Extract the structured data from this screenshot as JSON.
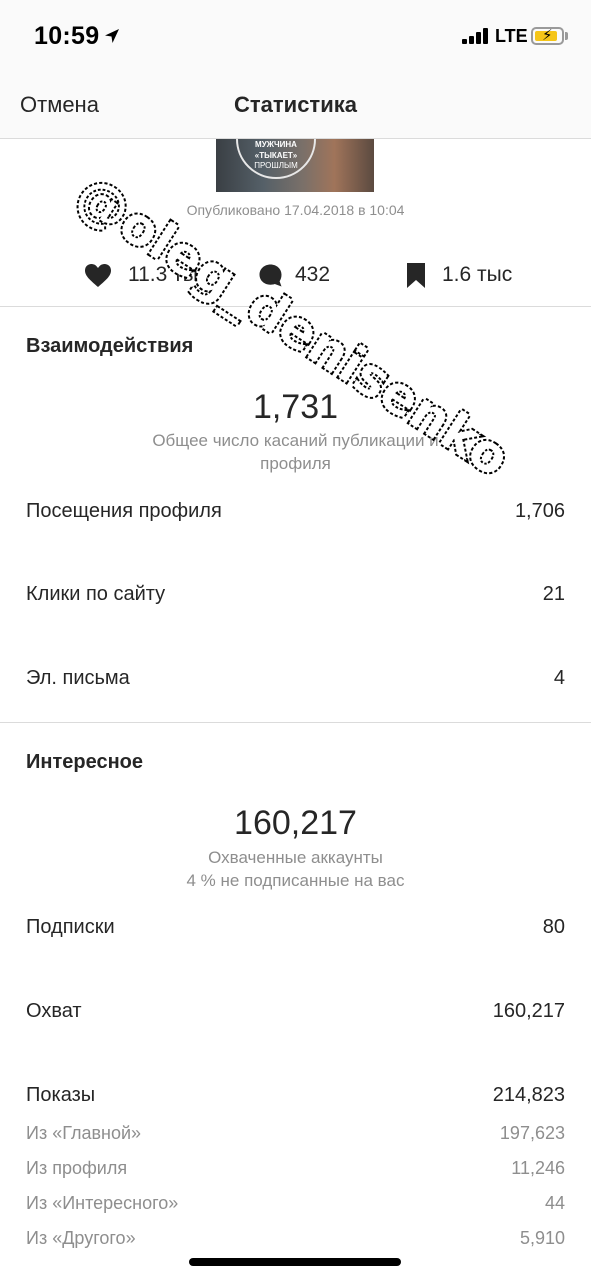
{
  "status_bar": {
    "time": "10:59",
    "network": "LTE",
    "battery_color": "#f5c518",
    "icons": [
      "location-arrow-icon",
      "signal-bars-icon",
      "battery-charging-icon"
    ]
  },
  "nav": {
    "cancel_label": "Отмена",
    "title": "Статистика"
  },
  "post": {
    "thumbnail_text": [
      "МУЖЧИНА",
      "«ТЫКАЕТ»",
      "ПРОШЛЫМ"
    ],
    "published_label": "Опубликовано 17.04.2018 в 10:04"
  },
  "engagement": {
    "likes": "11.3 тыс",
    "comments": "432",
    "saves": "1.6 тыс"
  },
  "interactions": {
    "title": "Взаимодействия",
    "total": "1,731",
    "total_caption_line1": "Общее число касаний публикации и",
    "total_caption_line2": "профиля",
    "rows": [
      {
        "label": "Посещения профиля",
        "value": "1,706"
      },
      {
        "label": "Клики по сайту",
        "value": "21"
      },
      {
        "label": "Эл. письма",
        "value": "4"
      }
    ]
  },
  "discovery": {
    "title": "Интересное",
    "total": "160,217",
    "caption_line1": "Охваченные аккаунты",
    "caption_line2": "4 % не подписанные на вас",
    "rows": [
      {
        "label": "Подписки",
        "value": "80"
      },
      {
        "label": "Охват",
        "value": "160,217"
      },
      {
        "label": "Показы",
        "value": "214,823"
      }
    ],
    "impression_sources": [
      {
        "label": "Из «Главной»",
        "value": "197,623"
      },
      {
        "label": "Из профиля",
        "value": "11,246"
      },
      {
        "label": "Из «Интересного»",
        "value": "44"
      },
      {
        "label": "Из «Другого»",
        "value": "5,910"
      }
    ]
  },
  "watermark": {
    "text": "@oleg_denisenko"
  },
  "colors": {
    "text": "#262626",
    "secondary_text": "#8e8e8e",
    "divider": "#dbdbdb",
    "header_bg": "#fafafa"
  }
}
